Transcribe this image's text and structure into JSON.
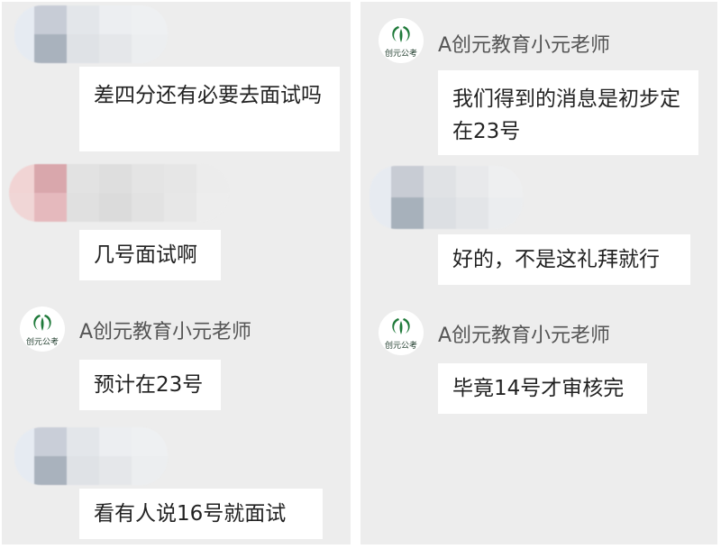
{
  "left_panel": {
    "messages": [
      {
        "type": "user",
        "text": "差四分还有必要去面试吗"
      },
      {
        "type": "user",
        "text": "几号面试啊"
      },
      {
        "type": "teacher",
        "sender": "A创元教育小元老师",
        "text": "预计在23号"
      },
      {
        "type": "user",
        "text": "看有人说16号就面试"
      }
    ]
  },
  "right_panel": {
    "messages": [
      {
        "type": "teacher",
        "sender": "A创元教育小元老师",
        "text": "我们得到的消息是初步定在23号"
      },
      {
        "type": "user",
        "text": "好的，不是这礼拜就行"
      },
      {
        "type": "teacher",
        "sender": "A创元教育小元老师",
        "text": "毕竟14号才审核完"
      }
    ]
  },
  "logo": {
    "text": "创元公考",
    "icon": "chuangyuan-logo-icon",
    "color": "#1f7a3a"
  }
}
